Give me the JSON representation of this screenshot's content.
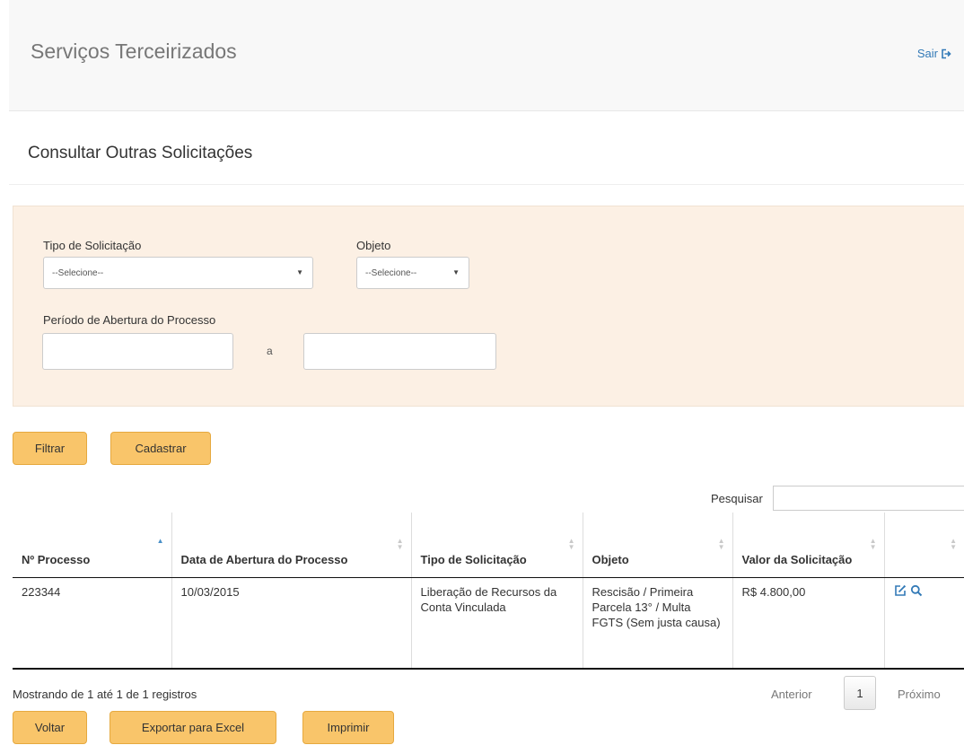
{
  "header": {
    "title": "Serviços Terceirizados",
    "logout_label": "Sair",
    "logout_icon": "sign-out-icon"
  },
  "page": {
    "title": "Consultar Outras Solicitações"
  },
  "filters": {
    "tipo_label": "Tipo de Solicitação",
    "tipo_value": "--Selecione--",
    "objeto_label": "Objeto",
    "objeto_value": "--Selecione--",
    "periodo_label": "Período de Abertura do Processo",
    "periodo_separator": "a",
    "periodo_inicio": "",
    "periodo_fim": ""
  },
  "actions": {
    "filtrar": "Filtrar",
    "cadastrar": "Cadastrar"
  },
  "search": {
    "label": "Pesquisar",
    "value": ""
  },
  "table": {
    "headers": [
      "Nº Processo",
      "Data de Abertura do Processo",
      "Tipo de Solicitação",
      "Objeto",
      "Valor da Solicitação",
      ""
    ],
    "rows": [
      {
        "processo": "223344",
        "data": "10/03/2015",
        "tipo": "Liberação de Recursos da Conta Vinculada",
        "objeto": "Rescisão / Primeira Parcela 13° / Multa FGTS (Sem justa causa)",
        "valor": "R$ 4.800,00",
        "icons": [
          "edit-icon",
          "search-icon"
        ]
      }
    ]
  },
  "pagination": {
    "info": "Mostrando de 1 até 1 de 1 registros",
    "prev": "Anterior",
    "page": "1",
    "next": "Próximo"
  },
  "footer_buttons": {
    "voltar": "Voltar",
    "exportar": "Exportar para Excel",
    "imprimir": "Imprimir"
  },
  "colors": {
    "accent_button": "#f9c56a",
    "filter_panel_bg": "#fcf0e4",
    "link": "#337ab7"
  }
}
